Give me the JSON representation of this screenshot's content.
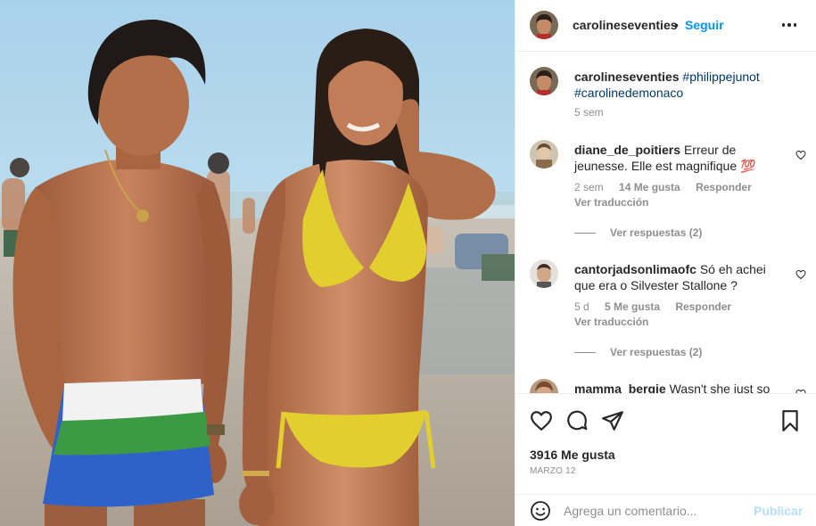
{
  "post": {
    "username": "carolineseventies",
    "dot": "•",
    "follow_label": "Seguir",
    "more_icon": "more-horizontal-icon"
  },
  "caption": {
    "username": "carolineseventies",
    "tags": [
      "#philippejunot",
      "#carolinedemonaco"
    ],
    "time": "5 sem"
  },
  "comments": [
    {
      "username": "diane_de_poitiers",
      "text": "Erreur de jeunesse. Elle est magnifique 💯",
      "time": "2 sem",
      "likes": "14 Me gusta",
      "reply_label": "Responder",
      "translate_label": "Ver traducción",
      "view_replies": "Ver respuestas (2)"
    },
    {
      "username": "cantorjadsonlimaofc",
      "text": "Só eh achei que era o Silvester Stallone ?",
      "time": "5 d",
      "likes": "5 Me gusta",
      "reply_label": "Responder",
      "translate_label": "Ver traducción",
      "view_replies": "Ver respuestas (2)"
    },
    {
      "username": "mamma_bergie",
      "text": "Wasn't she just so"
    }
  ],
  "actions": {
    "like_icon": "heart-icon",
    "comment_icon": "comment-icon",
    "share_icon": "send-icon",
    "save_icon": "bookmark-icon",
    "likes_count": "3916 Me gusta",
    "date": "MARZO 12"
  },
  "add_comment": {
    "placeholder": "Agrega un comentario...",
    "publish_label": "Publicar",
    "emoji_icon": "emoji-icon"
  },
  "colors": {
    "link_blue": "#0095f6",
    "hashtag": "#00376b",
    "muted": "#8e8e8e",
    "publish_disabled": "#b2dffc"
  }
}
